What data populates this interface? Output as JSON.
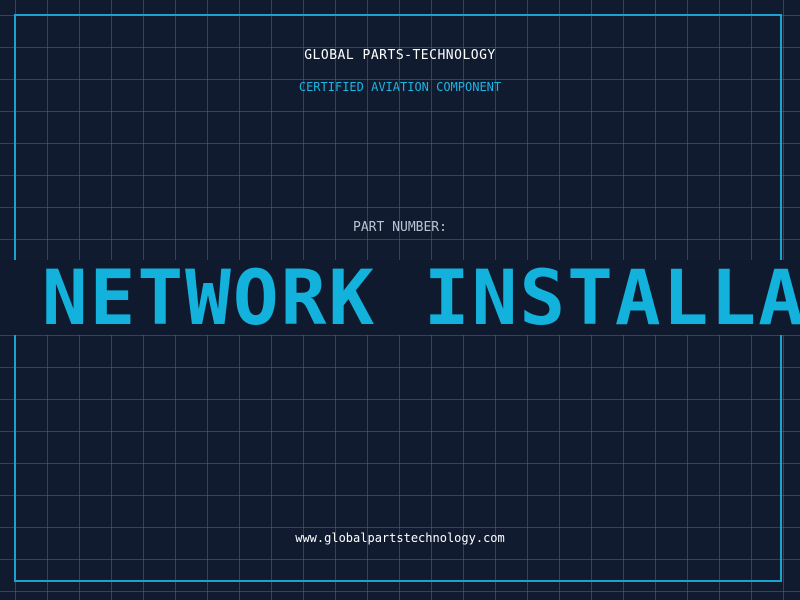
{
  "header": {
    "company": "GLOBAL PARTS-TECHNOLOGY",
    "tagline": "CERTIFIED AVIATION COMPONENT"
  },
  "part": {
    "label": "PART NUMBER:",
    "value": "H NETWORK INSTALLAT"
  },
  "footer": {
    "website": "www.globalpartstechnology.com"
  },
  "colors": {
    "background": "#101b30",
    "grid": "#28768c",
    "accent": "#1aa3cc",
    "part_text": "#12b2dc",
    "label_text": "#b9c4d4",
    "white": "#ffffff"
  }
}
